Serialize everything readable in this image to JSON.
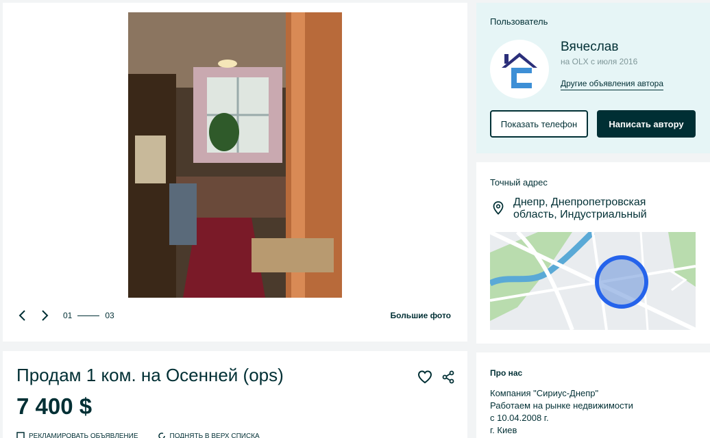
{
  "gallery": {
    "prev_icon": "chevron-left-icon",
    "next_icon": "chevron-right-icon",
    "current": "01",
    "total": "03",
    "big_photo_label": "Большие фото"
  },
  "user": {
    "section_label": "Пользователь",
    "name": "Вячеслав",
    "since": "на OLX с июля 2016",
    "other_ads_label": "Другие объявления автора",
    "show_phone_label": "Показать телефон",
    "write_author_label": "Написать автору",
    "colors": {
      "bg": "#e6f5f6",
      "primary": "#002f34"
    }
  },
  "address": {
    "section_label": "Точный адрес",
    "text": "Днепр, Днепропетровская область, Индустриальный"
  },
  "listing": {
    "title": "Продам 1 ком. на Осенней (ops)",
    "price": "7 400 $",
    "promo_items": [
      {
        "icon": "checkbox-icon",
        "label": "РЕКЛАМИРОВАТЬ ОБЪЯВЛЕНИЕ"
      },
      {
        "icon": "refresh-icon",
        "label": "ПОДНЯТЬ В ВЕРХ СПИСКА"
      }
    ]
  },
  "about": {
    "section_label": "Про нас",
    "lines": [
      "Компания \"Сириус-Днепр\"",
      "Работаем на рынке недвижимости",
      "с 10.04.2008 г.",
      "г. Киев"
    ]
  }
}
